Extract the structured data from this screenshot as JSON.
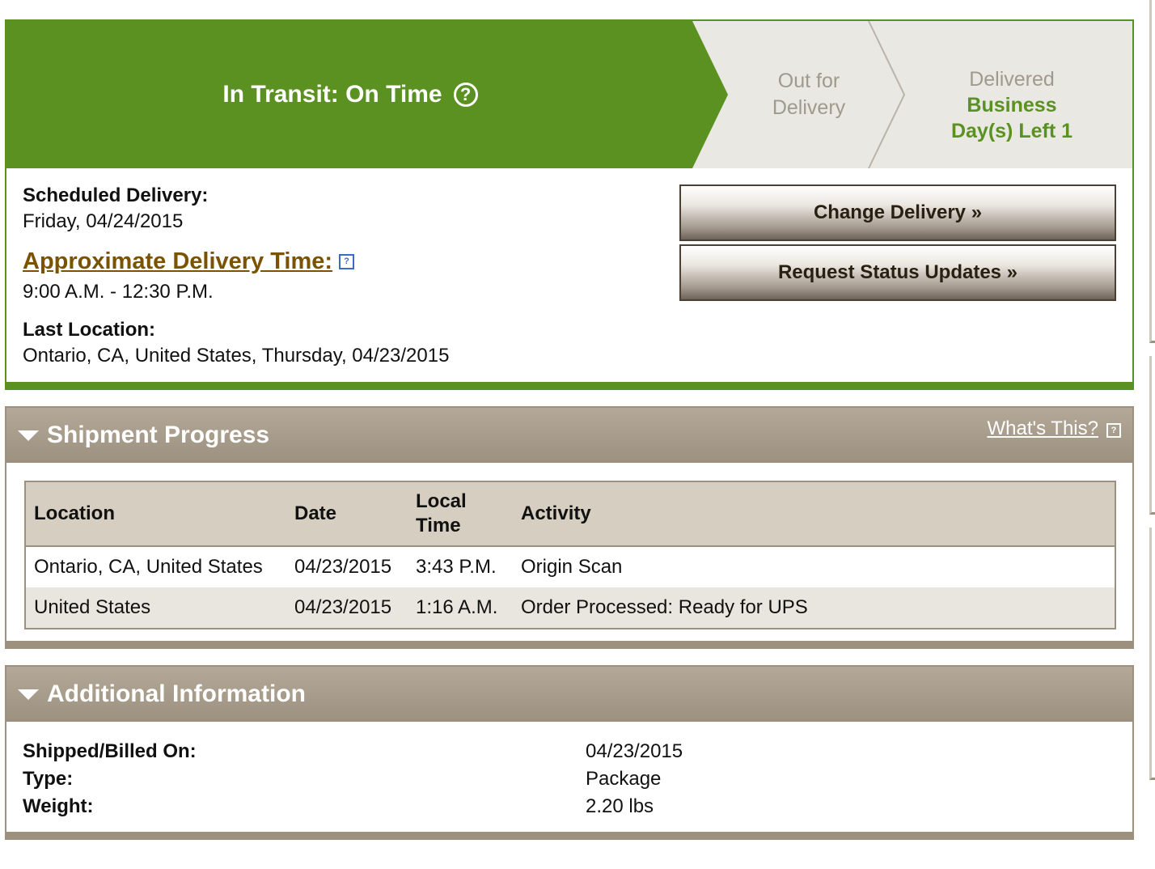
{
  "status": {
    "current_step": "In Transit: On Time",
    "help_glyph": "?",
    "next_step_line1": "Out for",
    "next_step_line2": "Delivery",
    "final_step_label": "Delivered",
    "final_step_days_line1": "Business",
    "final_step_days_line2": "Day(s) Left 1",
    "colors": {
      "active": "#5a9120",
      "inactive": "#e9e8e2",
      "inactive_text": "#a09a8e"
    }
  },
  "delivery": {
    "scheduled_label": "Scheduled Delivery:",
    "scheduled_value": "Friday, 04/24/2015",
    "approx_label": "Approximate Delivery Time:",
    "approx_help": "?",
    "approx_value": "9:00 A.M. - 12:30 P.M.",
    "last_location_label": "Last Location:",
    "last_location_value": "Ontario, CA, United States, Thursday, 04/23/2015"
  },
  "actions": {
    "change_delivery": "Change Delivery »",
    "request_updates": "Request Status Updates »"
  },
  "shipment_progress": {
    "title": "Shipment Progress",
    "whats_this": "What's This?",
    "whats_this_help": "?",
    "columns": [
      "Location",
      "Date",
      "Local Time",
      "Activity"
    ],
    "rows": [
      [
        "Ontario, CA, United States",
        "04/23/2015",
        "3:43 P.M.",
        "Origin Scan"
      ],
      [
        "United States",
        "04/23/2015",
        "1:16 A.M.",
        "Order Processed: Ready for UPS"
      ]
    ]
  },
  "additional_info": {
    "title": "Additional Information",
    "items": [
      {
        "label": "Shipped/Billed On:",
        "value": "04/23/2015"
      },
      {
        "label": "Type:",
        "value": "Package"
      },
      {
        "label": "Weight:",
        "value": "2.20 lbs"
      }
    ]
  }
}
